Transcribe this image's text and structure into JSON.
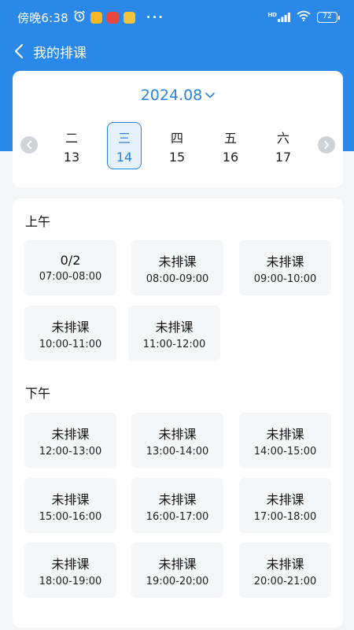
{
  "status_bar": {
    "time": "傍晚6:38",
    "dots": "···",
    "network": "HD",
    "battery": "72"
  },
  "header": {
    "title": "我的排课"
  },
  "calendar": {
    "month": "2024.08",
    "days": [
      {
        "weekday": "二",
        "date": "13"
      },
      {
        "weekday": "三",
        "date": "14"
      },
      {
        "weekday": "四",
        "date": "15"
      },
      {
        "weekday": "五",
        "date": "16"
      },
      {
        "weekday": "六",
        "date": "17"
      }
    ]
  },
  "schedule": {
    "morning": {
      "title": "上午",
      "slots": [
        {
          "status": "0/2",
          "time": "07:00-08:00"
        },
        {
          "status": "未排课",
          "time": "08:00-09:00"
        },
        {
          "status": "未排课",
          "time": "09:00-10:00"
        },
        {
          "status": "未排课",
          "time": "10:00-11:00"
        },
        {
          "status": "未排课",
          "time": "11:00-12:00"
        }
      ]
    },
    "afternoon": {
      "title": "下午",
      "slots": [
        {
          "status": "未排课",
          "time": "12:00-13:00"
        },
        {
          "status": "未排课",
          "time": "13:00-14:00"
        },
        {
          "status": "未排课",
          "time": "14:00-15:00"
        },
        {
          "status": "未排课",
          "time": "15:00-16:00"
        },
        {
          "status": "未排课",
          "time": "16:00-17:00"
        },
        {
          "status": "未排课",
          "time": "17:00-18:00"
        },
        {
          "status": "未排课",
          "time": "18:00-19:00"
        },
        {
          "status": "未排课",
          "time": "19:00-20:00"
        },
        {
          "status": "未排课",
          "time": "20:00-21:00"
        }
      ]
    }
  },
  "colors": {
    "primary": "#2a88e8",
    "accent": "#2a82e0",
    "slot_bg": "#f5f6f8"
  }
}
